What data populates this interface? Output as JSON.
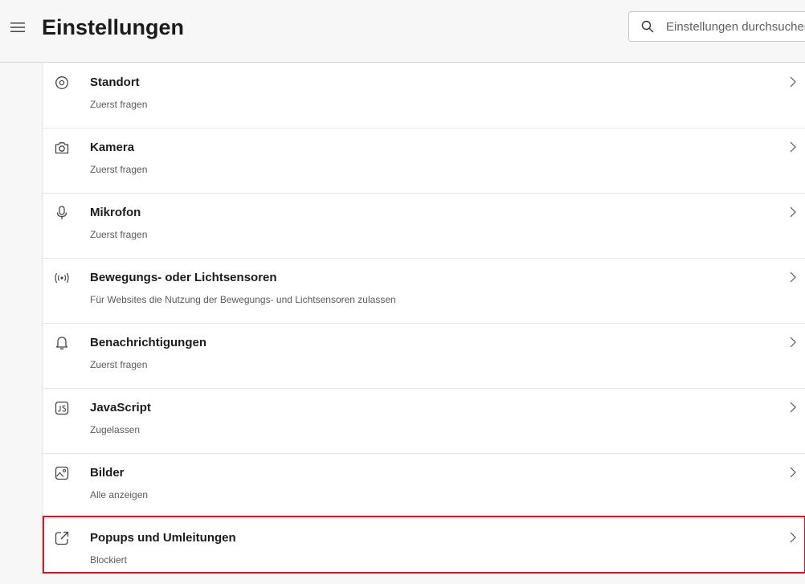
{
  "header": {
    "title": "Einstellungen",
    "search_placeholder": "Einstellungen durchsuchen"
  },
  "permissions": [
    {
      "icon": "location-icon",
      "title": "Standort",
      "subtitle": "Zuerst fragen"
    },
    {
      "icon": "camera-icon",
      "title": "Kamera",
      "subtitle": "Zuerst fragen"
    },
    {
      "icon": "microphone-icon",
      "title": "Mikrofon",
      "subtitle": "Zuerst fragen"
    },
    {
      "icon": "sensors-icon",
      "title": "Bewegungs- oder Lichtsensoren",
      "subtitle": "Für Websites die Nutzung der Bewegungs- und Lichtsensoren zulassen"
    },
    {
      "icon": "bell-icon",
      "title": "Benachrichtigungen",
      "subtitle": "Zuerst fragen"
    },
    {
      "icon": "javascript-icon",
      "title": "JavaScript",
      "subtitle": "Zugelassen"
    },
    {
      "icon": "image-icon",
      "title": "Bilder",
      "subtitle": "Alle anzeigen"
    },
    {
      "icon": "popup-icon",
      "title": "Popups und Umleitungen",
      "subtitle": "Blockiert"
    }
  ],
  "highlighted_item": "Popups und Umleitungen",
  "colors": {
    "highlight_border": "#e0101d",
    "background": "#f7f7f7",
    "card": "#ffffff"
  }
}
